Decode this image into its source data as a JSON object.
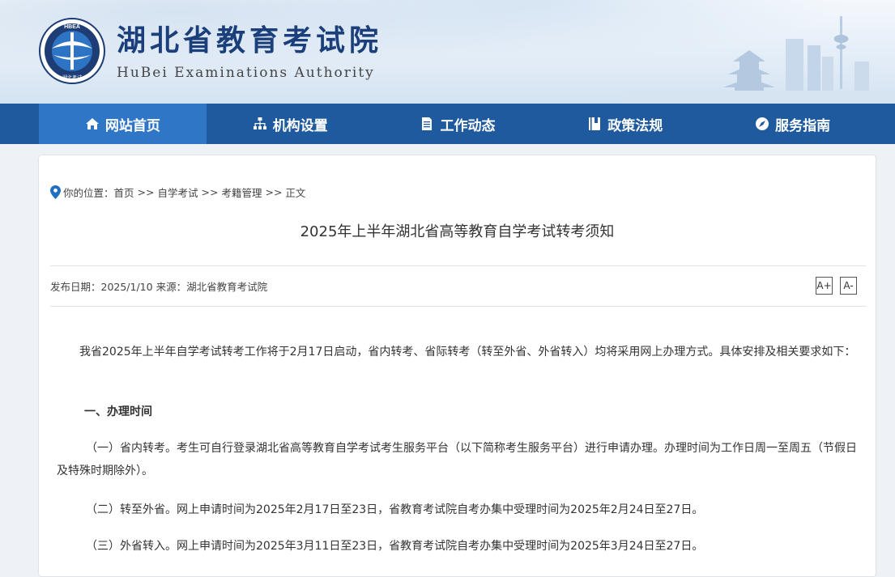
{
  "header": {
    "logo_text": "HBEA 湖北考试",
    "site_title": "湖北省教育考试院",
    "site_subtitle": "HuBei Examinations Authority"
  },
  "nav": {
    "items": [
      {
        "label": "网站首页",
        "icon": "home-icon",
        "active": true
      },
      {
        "label": "机构设置",
        "icon": "org-chart-icon",
        "active": false
      },
      {
        "label": "工作动态",
        "icon": "document-icon",
        "active": false
      },
      {
        "label": "政策法规",
        "icon": "book-icon",
        "active": false
      },
      {
        "label": "服务指南",
        "icon": "compass-icon",
        "active": false
      }
    ]
  },
  "breadcrumb": {
    "prefix": "你的位置：",
    "items": [
      "首页",
      "自学考试",
      "考籍管理",
      "正文"
    ],
    "separator": ">>"
  },
  "article": {
    "title": "2025年上半年湖北省高等教育自学考试转考须知",
    "meta": "发布日期：2025/1/10 来源：湖北省教育考试院",
    "font_increase": "A+",
    "font_decrease": "A-",
    "paragraphs": [
      "我省2025年上半年自学考试转考工作将于2月17日启动，省内转考、省际转考（转至外省、外省转入）均将采用网上办理方式。具体安排及相关要求如下：",
      "一、办理时间",
      "（一）省内转考。考生可自行登录湖北省高等教育自学考试考生服务平台（以下简称考生服务平台）进行申请办理。办理时间为工作日周一至周五（节假日及特殊时期除外）。",
      "（二）转至外省。网上申请时间为2025年2月17日至23日，省教育考试院自考办集中受理时间为2025年2月24日至27日。",
      "（三）外省转入。网上申请时间为2025年3月11日至23日，省教育考试院自考办集中受理时间为2025年3月24日至27日。"
    ]
  },
  "colors": {
    "nav_bg": "#1f5a9e",
    "nav_active": "#2f76c6",
    "title_blue": "#1b3f7a"
  }
}
